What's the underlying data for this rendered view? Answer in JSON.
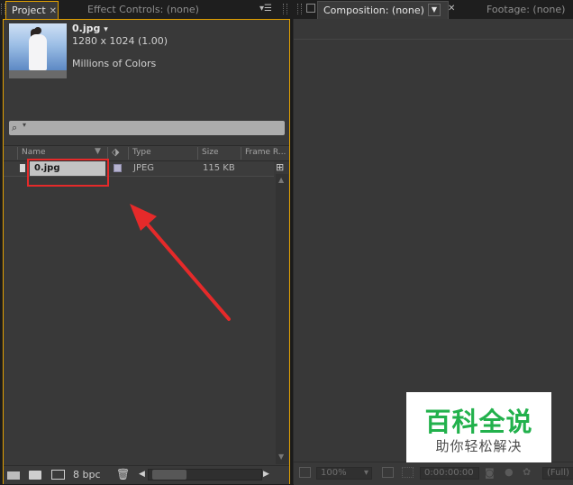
{
  "left_tabs": {
    "project": "Project",
    "effect_controls": "Effect Controls: (none)"
  },
  "right_tabs": {
    "composition": "Composition: (none)",
    "footage": "Footage: (none)"
  },
  "asset": {
    "name": "0.jpg",
    "name_arrow": "▾",
    "dimensions": "1280 x 1024 (1.00)",
    "colors": "Millions of Colors"
  },
  "columns": {
    "name": "Name",
    "type": "Type",
    "size": "Size",
    "frame_rate": "Frame R..."
  },
  "items": [
    {
      "name": "0.jpg",
      "type": "JPEG",
      "size": "115 KB",
      "label_color": "#b6b3cf"
    }
  ],
  "bottom_bar": {
    "bit_depth": "8 bpc"
  },
  "comp_footer": {
    "zoom": "100%",
    "timecode": "0:00:00:00",
    "resolution": "(Full)"
  },
  "watermark": {
    "title": "百科全说",
    "subtitle": "助你轻松解决"
  },
  "colors": {
    "panel_bg": "#393939",
    "active_border": "#e3a100",
    "selected_row": "#c3c3c3",
    "highlight_red": "#e52a2a",
    "watermark_green": "#22b14c"
  }
}
